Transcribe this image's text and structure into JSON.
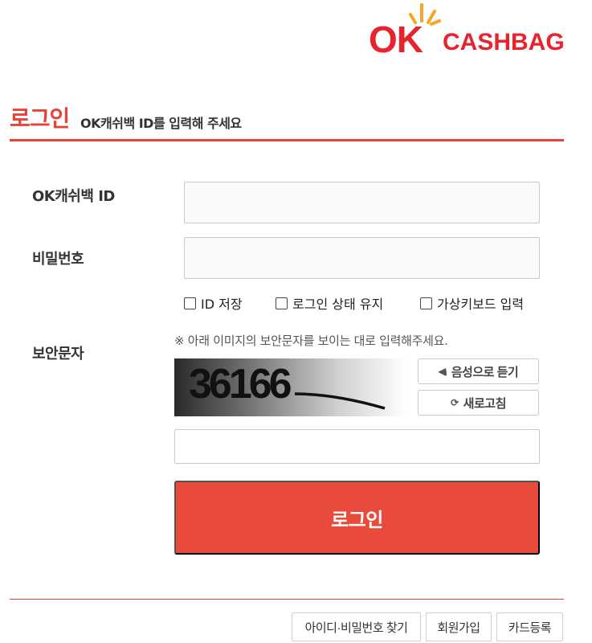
{
  "brand": {
    "logo_ok": "OK",
    "logo_text": "CASHBAG",
    "color": "#e8232d"
  },
  "header": {
    "title": "로그인",
    "subtitle": "OK캐쉬백 ID를 입력해 주세요"
  },
  "form": {
    "id_label": "OK캐쉬백 ID",
    "id_value": "",
    "password_label": "비밀번호",
    "password_value": "",
    "checkboxes": [
      {
        "label": "ID 저장",
        "checked": false
      },
      {
        "label": "로그인 상태 유지",
        "checked": false
      },
      {
        "label": "가상키보드 입력",
        "checked": false
      }
    ],
    "captcha_label": "보안문자",
    "captcha_note": "※ 아래 이미지의 보안문자를 보이는 대로 입력해주세요.",
    "captcha_image_text": "36166",
    "captcha_value": "",
    "audio_button": "음성으로 듣기",
    "audio_icon": "speaker-icon",
    "refresh_button": "새로고침",
    "refresh_icon": "refresh-icon",
    "login_button": "로그인",
    "login_color": "#e84b3c"
  },
  "footer": {
    "buttons": [
      "아이디·비밀번호 찾기",
      "회원가입",
      "카드등록"
    ]
  }
}
